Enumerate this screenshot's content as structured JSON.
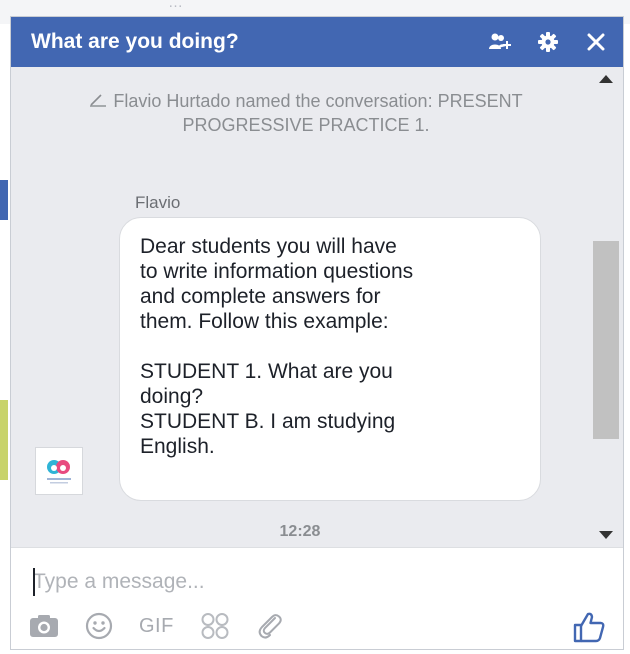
{
  "background": {
    "text": "…"
  },
  "chat": {
    "title": "What are you doing?",
    "colors": {
      "header": "#4267b2",
      "accent": "#4267b2",
      "convo_bg": "#eaebef"
    },
    "header_icons": [
      "add-people-icon",
      "gear-icon",
      "close-icon"
    ],
    "system_message": "Flavio Hurtado named the conversation: PRESENT PROGRESSIVE PRACTICE 1.",
    "sender": "Flavio",
    "message": "Dear students you will have\nto write information questions\nand complete answers for\nthem. Follow this example:\n\nSTUDENT 1. What are you\ndoing?\nSTUDENT B. I am studying\nEnglish.",
    "timestamp": "12:28",
    "composer": {
      "placeholder": "Type a message...",
      "value": "",
      "tools": [
        "camera-icon",
        "emoji-icon",
        "GIF",
        "stickers-icon",
        "attachment-icon"
      ],
      "like_icon": "thumbs-up-icon"
    }
  }
}
